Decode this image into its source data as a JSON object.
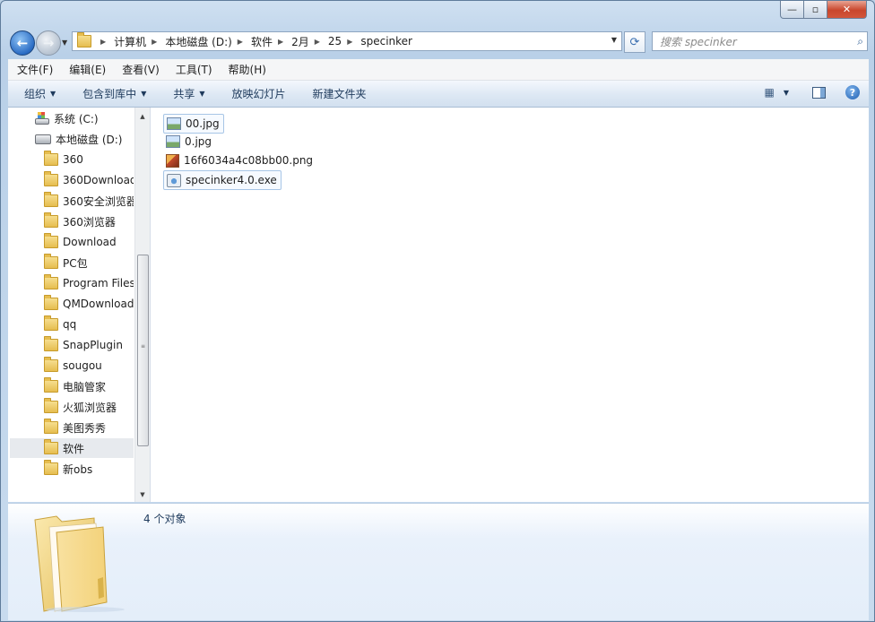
{
  "window": {
    "caption": {
      "minimize": "—",
      "maximize": "▫",
      "close": "✕"
    }
  },
  "address_bar": {
    "crumbs": [
      "计算机",
      "本地磁盘 (D:)",
      "软件",
      "2月",
      "25",
      "specinker"
    ]
  },
  "search": {
    "placeholder": "搜索 specinker"
  },
  "menu": [
    "文件(F)",
    "编辑(E)",
    "查看(V)",
    "工具(T)",
    "帮助(H)"
  ],
  "toolbar": {
    "organize": "组织",
    "include_in_library": "包含到库中",
    "share": "共享",
    "slideshow": "放映幻灯片",
    "new_folder": "新建文件夹"
  },
  "nav_pane": {
    "items": [
      {
        "label": "系统 (C:)",
        "icon": "system-drive-icon"
      },
      {
        "label": "本地磁盘 (D:)",
        "icon": "drive-icon"
      },
      {
        "label": "360",
        "icon": "folder-icon"
      },
      {
        "label": "360Download",
        "icon": "folder-icon"
      },
      {
        "label": "360安全浏览器",
        "icon": "folder-icon"
      },
      {
        "label": "360浏览器",
        "icon": "folder-icon"
      },
      {
        "label": "Download",
        "icon": "folder-icon"
      },
      {
        "label": "PC包",
        "icon": "folder-icon"
      },
      {
        "label": "Program Files",
        "icon": "folder-icon"
      },
      {
        "label": "QMDownload",
        "icon": "folder-icon"
      },
      {
        "label": "qq",
        "icon": "folder-icon"
      },
      {
        "label": "SnapPlugin",
        "icon": "folder-icon"
      },
      {
        "label": "sougou",
        "icon": "folder-icon"
      },
      {
        "label": "电脑管家",
        "icon": "folder-icon"
      },
      {
        "label": "火狐浏览器",
        "icon": "folder-icon"
      },
      {
        "label": "美图秀秀",
        "icon": "folder-icon"
      },
      {
        "label": "软件",
        "icon": "folder-icon",
        "selected": true
      },
      {
        "label": "新obs",
        "icon": "folder-icon"
      }
    ]
  },
  "files": [
    {
      "name": "00.jpg",
      "icon": "jpg-image-icon"
    },
    {
      "name": "0.jpg",
      "icon": "jpg-image-icon"
    },
    {
      "name": "16f6034a4c08bb00.png",
      "icon": "png-image-icon"
    },
    {
      "name": "specinker4.0.exe",
      "icon": "exe-app-icon"
    }
  ],
  "details": {
    "count": "4 个对象"
  }
}
